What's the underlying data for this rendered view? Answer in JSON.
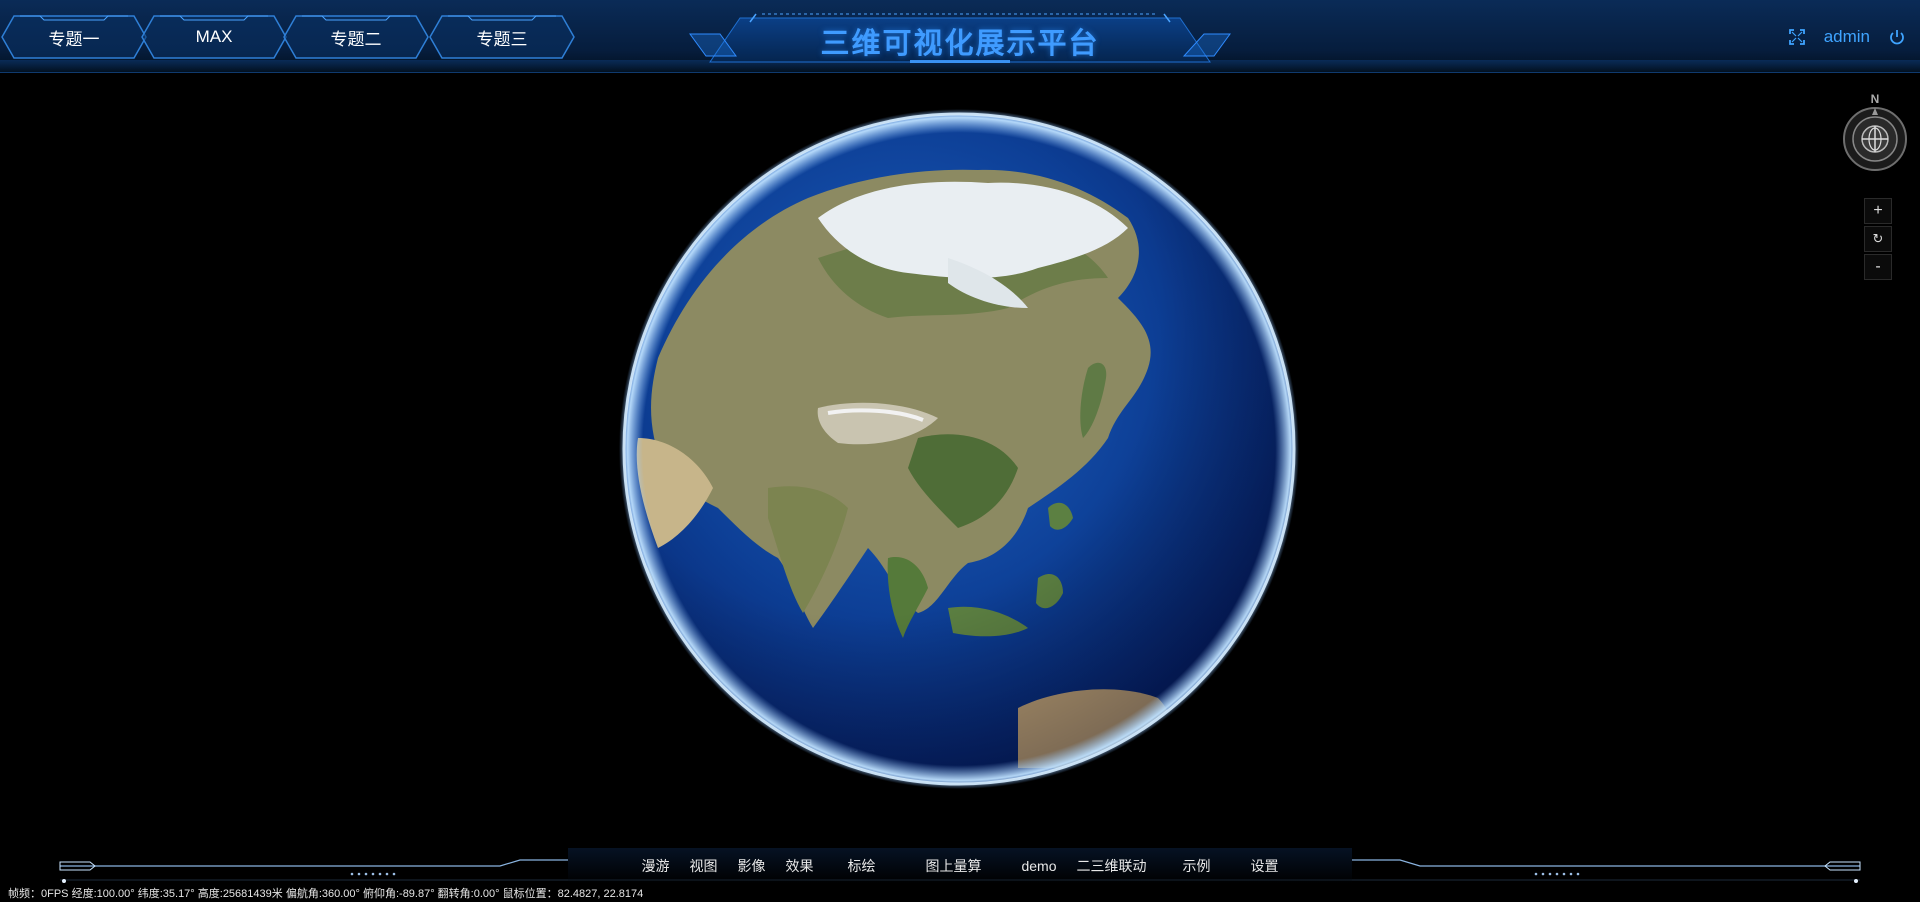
{
  "header": {
    "title": "三维可视化展示平台",
    "tabs": [
      {
        "label": "专题一"
      },
      {
        "label": "MAX"
      },
      {
        "label": "专题二"
      },
      {
        "label": "专题三"
      }
    ],
    "user": "admin",
    "icons": [
      "fullscreen-icon",
      "power-icon"
    ]
  },
  "nav_controls": {
    "compass_label": "N",
    "zoom_in": "+",
    "reset": "↻",
    "zoom_out": "-"
  },
  "bottom_menu": {
    "items": [
      "漫游",
      "视图",
      "影像",
      "效果",
      "标绘",
      "图上量算",
      "demo",
      "二三维联动",
      "示例",
      "设置"
    ]
  },
  "status_bar": {
    "text": "帧频：0FPS 经度:100.00° 纬度:35.17° 高度:25681439米 偏航角:360.00° 俯仰角:-89.87° 翻转角:0.00° 鼠标位置：82.4827, 22.8174"
  },
  "colors": {
    "accent": "#3f9bff",
    "header_bg": "#061d3d",
    "background": "#000000"
  }
}
